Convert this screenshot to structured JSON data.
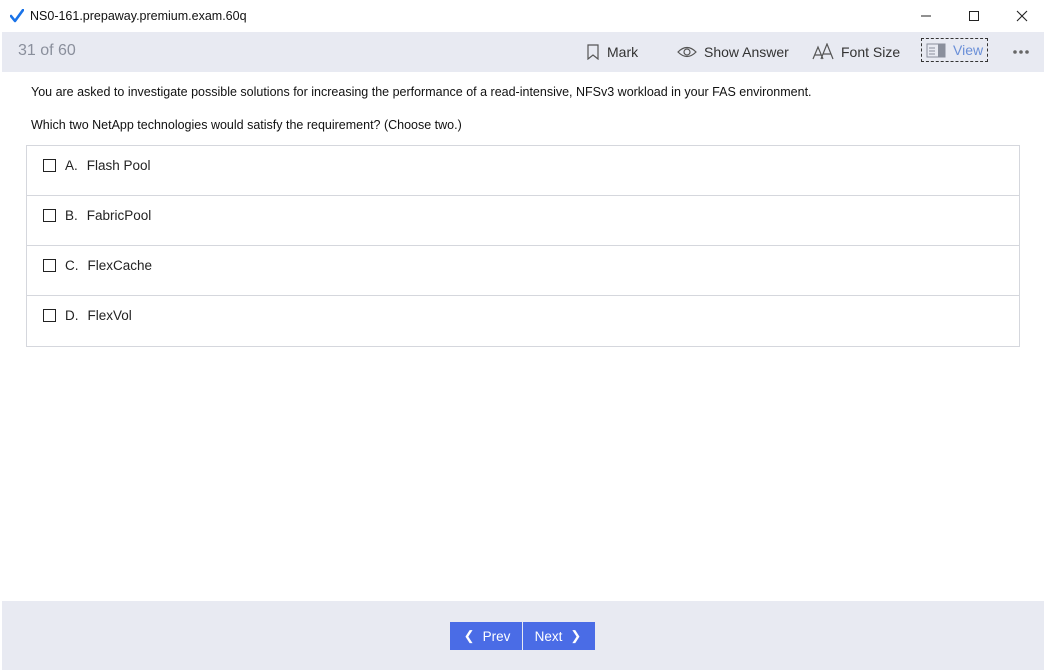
{
  "window": {
    "title": "NS0-161.prepaway.premium.exam.60q",
    "controls": [
      "minimize",
      "maximize",
      "close"
    ]
  },
  "toolbar": {
    "counter": "31 of 60",
    "mark_label": "Mark",
    "show_answer_label": "Show Answer",
    "font_size_label": "Font Size",
    "view_label": "View"
  },
  "question": {
    "text": "You are asked to investigate possible solutions for increasing the performance of a read-intensive, NFSv3 workload in your FAS environment.",
    "prompt": "Which two NetApp technologies would satisfy the requirement? (Choose two.)"
  },
  "options": [
    {
      "letter": "A.",
      "text": "Flash Pool",
      "checked": false
    },
    {
      "letter": "B.",
      "text": "FabricPool",
      "checked": false
    },
    {
      "letter": "C.",
      "text": "FlexCache",
      "checked": false
    },
    {
      "letter": "D.",
      "text": "FlexVol",
      "checked": false
    }
  ],
  "footer": {
    "prev_label": "Prev",
    "next_label": "Next"
  },
  "colors": {
    "accent": "#4a6ce6",
    "toolbar_bg": "#e8eaf2",
    "view_text": "#6a8fd8",
    "app_icon": "#1a73e8"
  }
}
